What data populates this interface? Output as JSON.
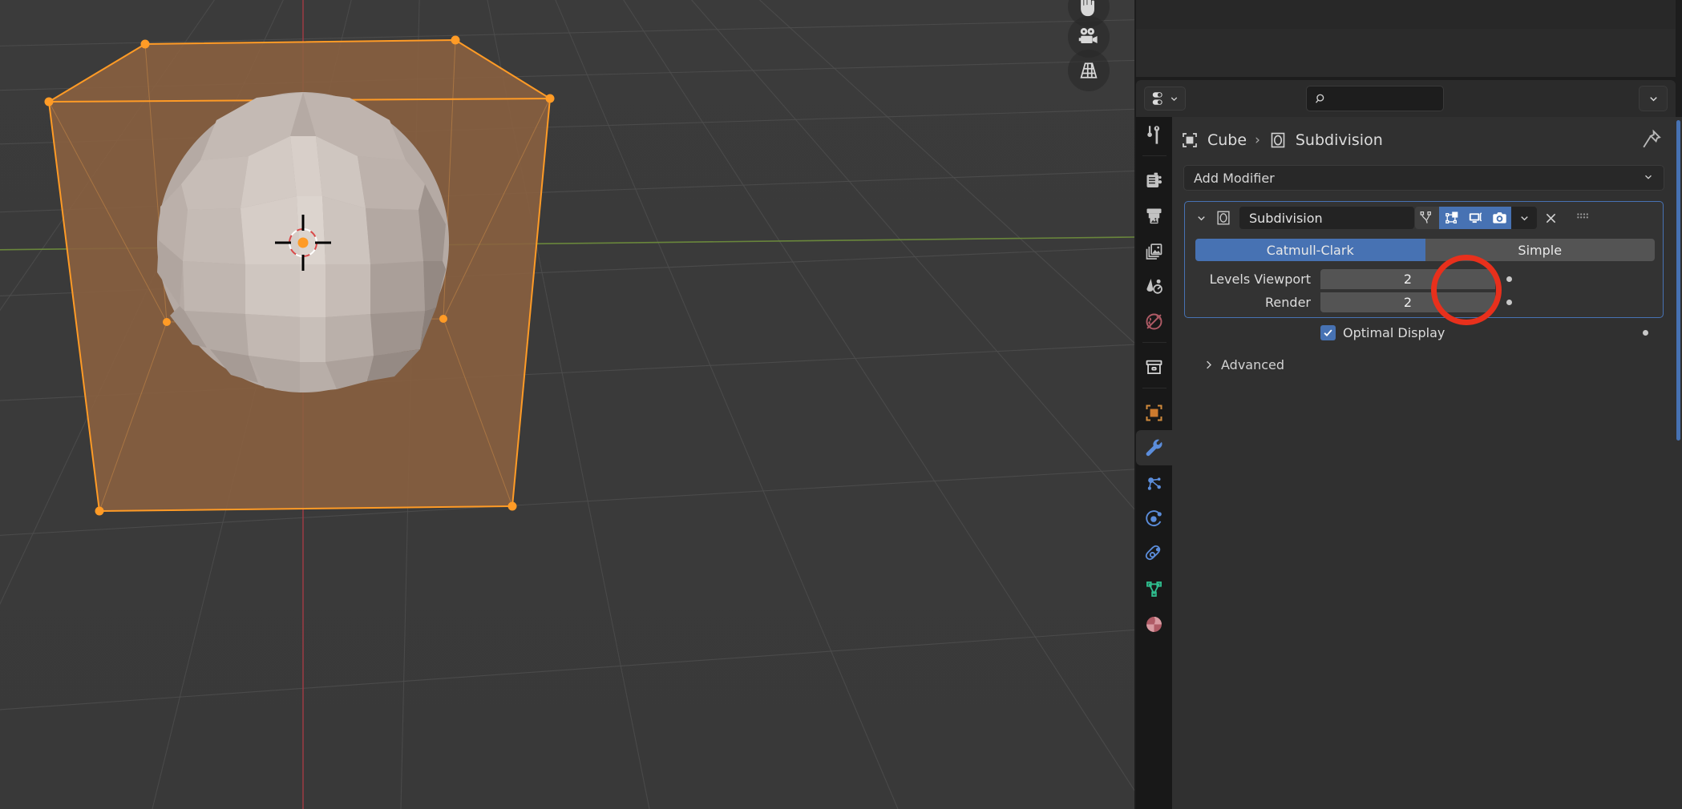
{
  "app": "Blender",
  "viewport": {
    "name": "3d-viewport",
    "gizmos": [
      {
        "name": "hand-pan-icon",
        "label": "Move View"
      },
      {
        "name": "camera-view-icon",
        "label": "Camera View"
      },
      {
        "name": "perspective-ortho-icon",
        "label": "Toggle Perspective/Orthographic"
      }
    ],
    "objects": [
      {
        "name": "Cube",
        "type": "mesh",
        "state": "selected",
        "display": "wireframe-bounds-orange"
      },
      {
        "name": "Subdivided Sphere",
        "type": "mesh",
        "state": "subdivided-preview"
      }
    ],
    "cursor": "3d-cursor",
    "colors": {
      "background": "#3a3a3a",
      "grid": "#4c4c4c",
      "selection_outline": "#ff9b26",
      "x_axis": "#9e3b42",
      "y_axis": "#6a8a3a",
      "object_fill": "#8b6140",
      "mesh_light": "#cdc5c0"
    }
  },
  "properties_editor": {
    "header": {
      "editor_type_icon": "properties-editor-icon",
      "search_placeholder": "",
      "search_value": "",
      "search_icon": "search-icon",
      "options_chevron": "chevron-down-icon"
    },
    "tabs": [
      {
        "name": "tool",
        "label": "Tool",
        "icon": "tool-icon",
        "active": false
      },
      {
        "name": "render",
        "label": "Render",
        "icon": "render-camera-back-icon",
        "active": false
      },
      {
        "name": "output",
        "label": "Output",
        "icon": "printer-output-icon",
        "active": false
      },
      {
        "name": "view-layer",
        "label": "View Layer",
        "icon": "images-stack-icon",
        "active": false
      },
      {
        "name": "scene",
        "label": "Scene",
        "icon": "scene-cone-icon",
        "active": false
      },
      {
        "name": "world",
        "label": "World",
        "icon": "world-globe-icon",
        "active": false
      },
      {
        "name": "collection",
        "label": "Collection",
        "icon": "collection-box-icon",
        "active": false
      },
      {
        "name": "object",
        "label": "Object",
        "icon": "object-square-icon",
        "active": false
      },
      {
        "name": "modifiers",
        "label": "Modifiers",
        "icon": "wrench-icon",
        "active": true
      },
      {
        "name": "particles",
        "label": "Particles",
        "icon": "particles-icon",
        "active": false
      },
      {
        "name": "physics",
        "label": "Physics",
        "icon": "physics-orbit-icon",
        "active": false
      },
      {
        "name": "constraints",
        "label": "Object Constraints",
        "icon": "constraints-icon",
        "active": false
      },
      {
        "name": "object-data",
        "label": "Object Data",
        "icon": "mesh-data-triangle-icon",
        "active": false
      },
      {
        "name": "material",
        "label": "Material",
        "icon": "material-sphere-icon",
        "active": false
      }
    ],
    "breadcrumb": {
      "object_icon": "object-square-icon",
      "object": "Cube",
      "separator": "›",
      "modifier_icon": "modifier-oval-icon",
      "modifier": "Subdivision",
      "pin_icon": "pin-icon"
    },
    "add_modifier": {
      "label": "Add Modifier",
      "caret_icon": "chevron-down-icon"
    },
    "modifier": {
      "expand_icon": "chevron-down-icon",
      "type_icon": "modifier-oval-icon",
      "name": "Subdivision",
      "toggles": [
        {
          "name": "on-cage",
          "label": "Display modifier in Edit mode on cage",
          "icon": "on-cage-vertices-icon",
          "enabled": false
        },
        {
          "name": "edit-mode",
          "label": "Display in Edit mode",
          "icon": "edit-mode-box-icon",
          "enabled": true
        },
        {
          "name": "realtime",
          "label": "Display in viewport",
          "icon": "monitor-icon",
          "enabled": true
        },
        {
          "name": "render",
          "label": "Render",
          "icon": "camera-icon",
          "enabled": true
        }
      ],
      "extras_icon": "chevron-down-icon",
      "close_icon": "close-x-icon",
      "grip_icon": "drag-grip-icon",
      "algorithm": {
        "options": [
          "Catmull-Clark",
          "Simple"
        ],
        "selected": "Catmull-Clark"
      },
      "fields": [
        {
          "name": "levels-viewport",
          "label": "Levels Viewport",
          "value": "2",
          "animate_dot": true
        },
        {
          "name": "render-levels",
          "label": "Render",
          "value": "2",
          "animate_dot": true
        }
      ],
      "checkbox": {
        "name": "optimal-display",
        "label": "Optimal Display",
        "checked": true,
        "check_icon": "check-icon",
        "animate_dot": true
      },
      "advanced": {
        "label": "Advanced",
        "expanded": false,
        "icon": "chevron-right-icon"
      }
    },
    "colors": {
      "accent_blue": "#4772b3",
      "panel_bg": "#303030",
      "card_bg": "#333333",
      "field_bg": "#545454",
      "dark_bg": "#1d1d1d",
      "tabcol_bg": "#181818"
    }
  },
  "annotation": {
    "name": "highlight-circle",
    "shape": "circle",
    "color": "#e8301c",
    "target": "edit-mode-box-icon"
  }
}
